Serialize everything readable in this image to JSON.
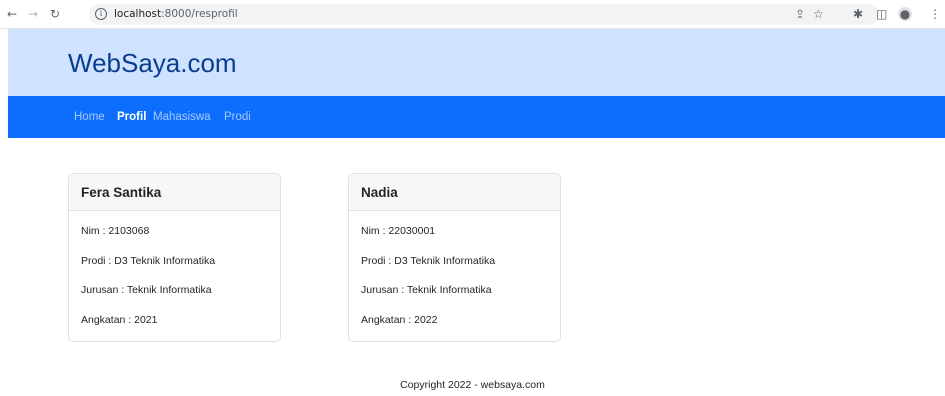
{
  "browser": {
    "url_host": "localhost",
    "url_path": ":8000/resprofil",
    "icons": [
      "back-icon",
      "forward-icon",
      "reload-icon",
      "info-icon",
      "share-icon",
      "star-icon",
      "extensions-icon",
      "sidebar-icon",
      "profile-icon",
      "menu-icon"
    ]
  },
  "header": {
    "brand": "WebSaya.com",
    "background_color": "#cfe2ff"
  },
  "nav": {
    "background_color": "#0d6efd",
    "items": [
      {
        "label": "Home",
        "active": false
      },
      {
        "label": "Profil",
        "active": true
      },
      {
        "label": "Mahasiswa",
        "active": false
      },
      {
        "label": "Prodi",
        "active": false
      }
    ]
  },
  "profiles": [
    {
      "name": "Fera Santika",
      "nim": "Nim : 2103068",
      "prodi": "Prodi : D3 Teknik Informatika",
      "jurusan": "Jurusan : Teknik Informatika",
      "angkatan": "Angkatan : 2021"
    },
    {
      "name": "Nadia",
      "nim": "Nim : 22030001",
      "prodi": "Prodi : D3 Teknik Informatika",
      "jurusan": "Jurusan : Teknik Informatika",
      "angkatan": "Angkatan : 2022"
    }
  ],
  "footer": {
    "text": "Copyright 2022 - websaya.com"
  }
}
